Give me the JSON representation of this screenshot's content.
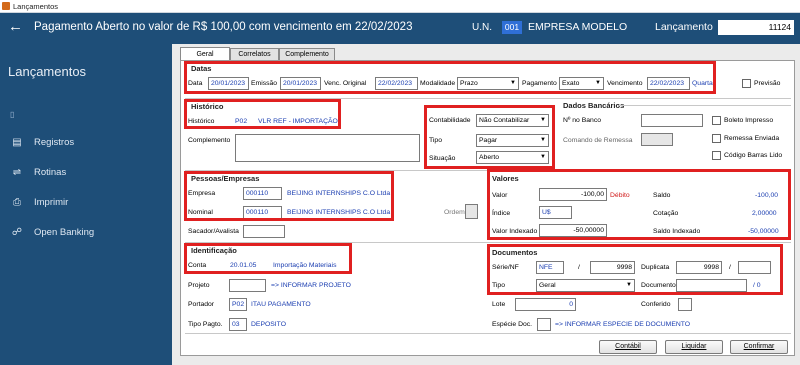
{
  "window": {
    "title": "Lançamentos"
  },
  "header": {
    "message": "Pagamento Aberto no valor de R$ 100,00 com vencimento em 22/02/2023",
    "un_label": "U.N.",
    "un_code": "001",
    "company": "EMPRESA MODELO",
    "lancamento_label": "Lançamento",
    "lancamento_value": "11124"
  },
  "sidebar": {
    "title": "Lançamentos",
    "items": [
      {
        "label": "Registros",
        "icon": "list-icon"
      },
      {
        "label": "Rotinas",
        "icon": "arrows-icon"
      },
      {
        "label": "Imprimir",
        "icon": "printer-icon"
      },
      {
        "label": "Open Banking",
        "icon": "network-icon"
      }
    ]
  },
  "tabs": [
    "Geral",
    "Correlatos",
    "Complemento"
  ],
  "datas": {
    "title": "Datas",
    "data_label": "Data",
    "data": "20/01/2023",
    "emissao_label": "Emissão",
    "emissao": "20/01/2023",
    "venc_original_label": "Venc. Original",
    "venc_original": "22/02/2023",
    "modalidade_label": "Modalidade",
    "modalidade": "Prazo",
    "pagamento_label": "Pagamento",
    "pagamento": "Exato",
    "vencimento_label": "Vencimento",
    "vencimento": "22/02/2023",
    "dia_semana": "Quarta",
    "previsao_label": "Previsão"
  },
  "historico": {
    "title": "Histórico",
    "label": "Histórico",
    "code": "P02",
    "text": "VLR REF - IMPORTAÇÃO",
    "complemento_label": "Complemento"
  },
  "contabil": {
    "contabilidade_label": "Contabilidade",
    "contabilidade": "Não Contabilizar",
    "tipo_label": "Tipo",
    "tipo": "Pagar",
    "situacao_label": "Situação",
    "situacao": "Aberto"
  },
  "bancarios": {
    "title": "Dados Bancários",
    "no_banco_label": "Nº no Banco",
    "comando_label": "Comando de Remessa",
    "boleto_label": "Boleto Impresso",
    "remessa_label": "Remessa Enviada",
    "codigo_barras_label": "Código Barras Lido"
  },
  "pessoas": {
    "title": "Pessoas/Empresas",
    "empresa_label": "Empresa",
    "empresa_code": "000110",
    "empresa_name": "BEIJING INTERNSHIPS C.O Ltda",
    "nominal_label": "Nominal",
    "nominal_code": "000110",
    "nominal_name": "BEIJING INTERNSHIPS C.O Ltda",
    "ordem_label": "Ordem",
    "sacador_label": "Sacador/Avalista"
  },
  "valores": {
    "title": "Valores",
    "valor_label": "Valor",
    "valor": "-100,00",
    "debito": "Débito",
    "indice_label": "Índice",
    "indice": "U$",
    "valor_indexado_label": "Valor Indexado",
    "valor_indexado": "-50,00000",
    "saldo_label": "Saldo",
    "saldo": "-100,00",
    "cotacao_label": "Cotação",
    "cotacao": "2,00000",
    "saldo_indexado_label": "Saldo Indexado",
    "saldo_indexado": "-50,00000"
  },
  "identificacao": {
    "title": "Identificação",
    "conta_label": "Conta",
    "conta_code": "20.01.05",
    "conta_name": "Importação Materiais",
    "projeto_label": "Projeto",
    "projeto_hint": "=> INFORMAR PROJETO",
    "portador_label": "Portador",
    "portador_code": "P02",
    "portador_name": "ITAU PAGAMENTO",
    "tipo_pagto_label": "Tipo Pagto.",
    "tipo_pagto_code": "03",
    "tipo_pagto_name": "DEPOSITO"
  },
  "documentos": {
    "title": "Documentos",
    "serie_label": "Série/NF",
    "serie": "NFE",
    "slash": "/",
    "nf": "9998",
    "duplicata_label": "Duplicata",
    "duplicata": "9998",
    "tipo_label": "Tipo",
    "tipo": "Geral",
    "documento_label": "Documento",
    "documento_suffix": "/ 0",
    "lote_label": "Lote",
    "lote": "0",
    "conferido_label": "Conferido",
    "especie_label": "Espécie Doc.",
    "especie_hint": "=> INFORMAR ESPECIE DE DOCUMENTO"
  },
  "buttons": {
    "contabil": "Contábil",
    "liquidar": "Liquidar",
    "confirmar": "Confirmar"
  }
}
